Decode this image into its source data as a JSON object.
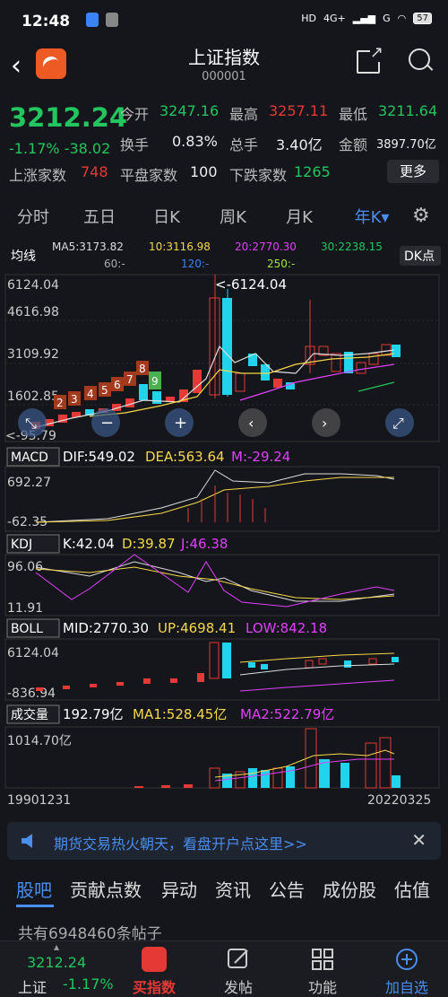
{
  "status": {
    "time": "12:48",
    "network": "4G+",
    "wifi": "G",
    "battery": "57"
  },
  "header": {
    "title": "上证指数",
    "code": "000001"
  },
  "quote": {
    "price": "3212.24",
    "change_pct": "-1.17%",
    "change_abs": "-38.02",
    "open_label": "今开",
    "open": "3247.16",
    "high_label": "最高",
    "high": "3257.11",
    "low_label": "最低",
    "low": "3211.64",
    "turnover_label": "换手",
    "turnover": "0.83%",
    "volume_label": "总手",
    "volume": "3.40亿",
    "amount_label": "金额",
    "amount": "3897.70亿",
    "rise_label": "上涨家数",
    "rise": "748",
    "flat_label": "平盘家数",
    "flat": "100",
    "fall_label": "下跌家数",
    "fall": "1265",
    "more": "更多"
  },
  "tabs": [
    "分时",
    "五日",
    "日K",
    "周K",
    "月K",
    "年K▾"
  ],
  "main_chart": {
    "ma_label": "均线",
    "ma5": "MA5:3173.82",
    "ma10": "10:3116.98",
    "ma20": "20:2770.30",
    "ma30": "30:2238.15",
    "ma60": "60:-",
    "ma120": "120:-",
    "ma250": "250:-",
    "dk": "DK点",
    "y_labels": [
      "6124.04",
      "4616.98",
      "3109.92",
      "1602.85",
      "95.79"
    ],
    "max_label": "<-6124.04",
    "min_label": "<-95.79",
    "markers": [
      "2",
      "3",
      "4",
      "5",
      "6",
      "7",
      "8",
      "9"
    ]
  },
  "macd": {
    "name": "MACD",
    "dif": "DIF:549.02",
    "dea": "DEA:563.64",
    "m": "M:-29.24",
    "y_top": "692.27",
    "y_bot": "-62.35"
  },
  "kdj": {
    "name": "KDJ",
    "k": "K:42.04",
    "d": "D:39.87",
    "j": "J:46.38",
    "y_top": "96.06",
    "y_bot": "11.91"
  },
  "boll": {
    "name": "BOLL",
    "mid": "MID:2770.30",
    "up": "UP:4698.41",
    "low": "LOW:842.18",
    "y_top": "6124.04",
    "y_bot": "-836.94"
  },
  "vol": {
    "name": "成交量",
    "value": "192.79亿",
    "ma1": "MA1:528.45亿",
    "ma2": "MA2:522.79亿",
    "y_top": "1014.70亿"
  },
  "x_axis": {
    "start": "19901231",
    "end": "20220325"
  },
  "banner": {
    "text": "期货交易热火朝天，看盘开户点这里>>"
  },
  "subtabs": [
    "股吧",
    "贡献点数",
    "异动",
    "资讯",
    "公告",
    "成份股",
    "估值"
  ],
  "posts": "共有6948460条帖子",
  "bottom": {
    "price": "3212.24",
    "name": "上证",
    "pct": "-1.17%",
    "buy": "买指数",
    "post": "发帖",
    "func": "功能",
    "add": "加自选"
  },
  "colors": {
    "up": "#e53935",
    "down": "#22c55e",
    "accent": "#4a8ef0",
    "candle_down": "#22d3ee"
  }
}
